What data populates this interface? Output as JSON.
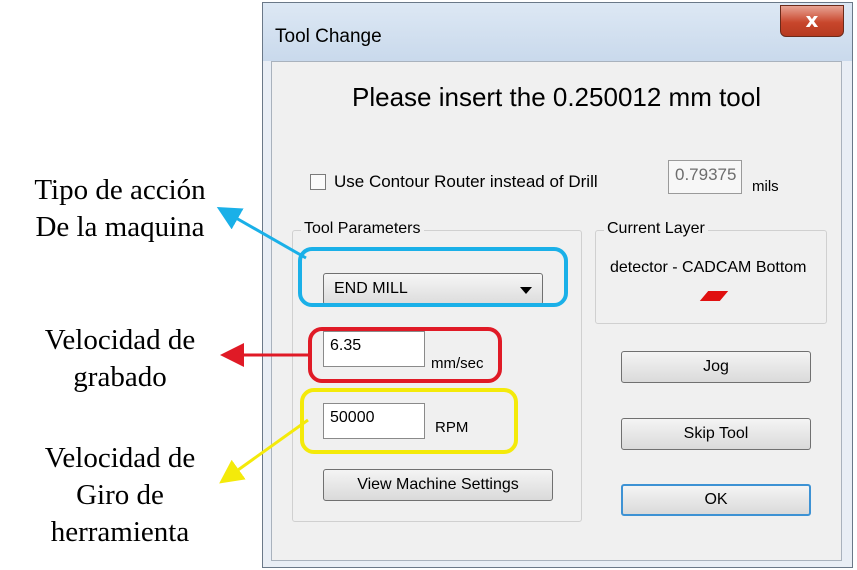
{
  "annotations": {
    "action_type": [
      "Tipo de acción",
      "De la maquina"
    ],
    "engrave_speed": [
      "Velocidad de",
      "grabado"
    ],
    "spin_speed": [
      "Velocidad de",
      "Giro de",
      "herramienta"
    ]
  },
  "dialog": {
    "title": "Tool Change",
    "close_label": "x",
    "headline": "Please insert the 0.250012 mm tool",
    "contour_checkbox_label": "Use Contour Router instead of Drill",
    "contour_checked": false,
    "mils_value": "0.79375",
    "mils_unit": "mils",
    "tool_parameters": {
      "legend": "Tool Parameters",
      "tool_type": "END MILL",
      "speed_value": "6.35",
      "speed_unit": "mm/sec",
      "rpm_value": "50000",
      "rpm_unit": "RPM",
      "view_settings_label": "View Machine Settings"
    },
    "current_layer": {
      "legend": "Current Layer",
      "name": "detector - CADCAM Bottom",
      "swatch_color": "#e01010"
    },
    "buttons": {
      "jog": "Jog",
      "skip": "Skip Tool",
      "ok": "OK"
    }
  },
  "highlight_colors": {
    "tool_type": "#1ab0e8",
    "speed": "#e01a26",
    "rpm": "#f4ea0a"
  }
}
